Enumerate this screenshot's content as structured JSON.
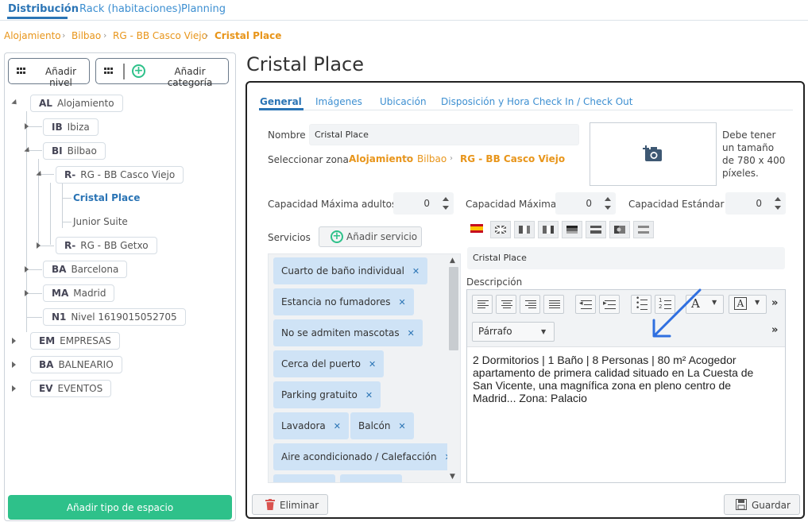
{
  "topnav": {
    "tabs": [
      {
        "label": "Distribución",
        "active": true
      },
      {
        "label": "Rack (habitaciones)",
        "active": false
      },
      {
        "label": "Planning",
        "active": false
      }
    ]
  },
  "breadcrumb": [
    "Alojamiento",
    "Bilbao",
    "RG - BB Casco Viejo",
    "Cristal Place"
  ],
  "sidebar": {
    "add_level": "Añadir nivel",
    "add_category": "Añadir categoría",
    "add_space_type": "Añadir tipo de espacio",
    "tree": [
      {
        "code": "AL",
        "label": "Alojamiento"
      },
      {
        "code": "IB",
        "label": "Ibiza"
      },
      {
        "code": "BI",
        "label": "Bilbao"
      },
      {
        "code": "R-",
        "label": "RG - BB Casco Viejo"
      },
      {
        "code": "",
        "label": "Cristal Place"
      },
      {
        "code": "",
        "label": "Junior Suite"
      },
      {
        "code": "R-",
        "label": "RG - BB Getxo"
      },
      {
        "code": "BA",
        "label": "Barcelona"
      },
      {
        "code": "MA",
        "label": "Madrid"
      },
      {
        "code": "N1",
        "label": "Nivel 1619015052705"
      },
      {
        "code": "EM",
        "label": "EMPRESAS"
      },
      {
        "code": "BA",
        "label": "BALNEARIO"
      },
      {
        "code": "EV",
        "label": "EVENTOS"
      }
    ]
  },
  "main": {
    "title": "Cristal Place",
    "tabs": [
      {
        "label": "General",
        "active": true
      },
      {
        "label": "Imágenes",
        "active": false
      },
      {
        "label": "Ubicación",
        "active": false
      },
      {
        "label": "Disposición y  Hora Check In / Check Out",
        "active": false
      }
    ],
    "name_label": "Nombre",
    "name_value": "Cristal Place",
    "zone_label": "Seleccionar zona",
    "zone_path": [
      "Alojamiento",
      "Bilbao",
      "RG - BB Casco Viejo"
    ],
    "photo_note": "Debe tener un tamaño de 780 x 400 píxeles.",
    "capacity": [
      {
        "label": "Capacidad Máxima adultos",
        "value": "0"
      },
      {
        "label": "Capacidad Máxima",
        "value": "0"
      },
      {
        "label": "Capacidad Estándar",
        "value": "0"
      }
    ],
    "services_label": "Servicios",
    "add_service": "Añadir servicio",
    "services": [
      "Cuarto de baño individual",
      "Estancia no fumadores",
      "No se admiten mascotas",
      "Cerca del puerto",
      "Parking gratuito",
      "Lavadora",
      "Balcón",
      "Aire acondicionado / Calefacción"
    ],
    "translated_name": "Cristal Place",
    "description_label": "Descripción",
    "paragraph_select": "Párrafo",
    "description_text": "2 Dormitorios | 1 Baño | 8 Personas | 80 m² Acogedor apartamento de primera calidad situado en La Cuesta de San Vicente, una magnífica zona en pleno centro de Madrid... Zona: Palacio",
    "delete_label": "Eliminar",
    "save_label": "Guardar"
  },
  "colors": {
    "accent": "#2a74b5",
    "orange": "#e8951a",
    "green": "#2ec18a",
    "chip": "#cfe3f6",
    "arrow": "#2f6fe0"
  }
}
